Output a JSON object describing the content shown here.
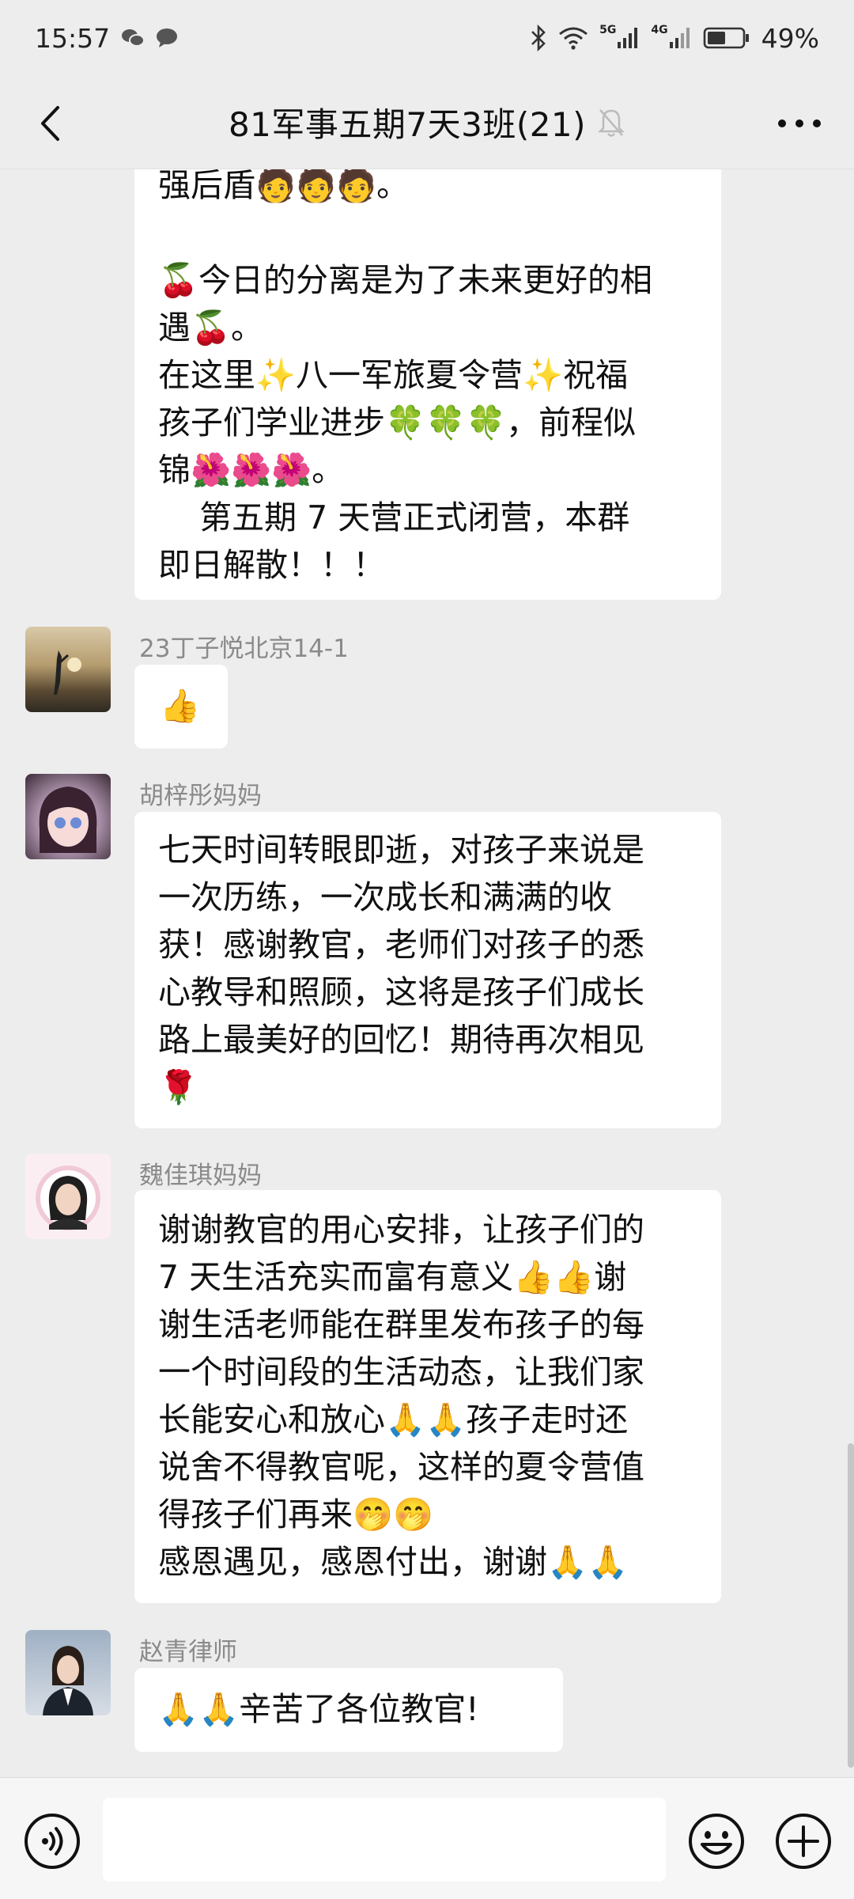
{
  "status_bar": {
    "time": "15:57",
    "battery": "49%",
    "net_5g": "5G",
    "net_4g": "4G"
  },
  "header": {
    "title": "81军事五期7天3班(21)"
  },
  "messages": [
    {
      "sender": "",
      "lines": [
        "强后盾🧑🧑🧑。",
        "",
        "🍒今日的分离是为了未来更好的相",
        "遇🍒。",
        "在这里✨八一军旅夏令营✨祝福",
        "孩子们学业进步🍀🍀🍀，前程似",
        "锦🌺🌺🌺。",
        "    第五期 7 天营正式闭营，本群",
        "即日解散！！！"
      ]
    },
    {
      "sender": "23丁子悦北京14-1",
      "lines": [
        "👍"
      ]
    },
    {
      "sender": "胡梓彤妈妈",
      "lines": [
        "七天时间转眼即逝，对孩子来说是",
        "一次历练，一次成长和满满的收",
        "获！感谢教官，老师们对孩子的悉",
        "心教导和照顾，这将是孩子们成长",
        "路上最美好的回忆！期待再次相见",
        "🌹"
      ]
    },
    {
      "sender": "魏佳琪妈妈",
      "lines": [
        "谢谢教官的用心安排，让孩子们的",
        "7 天生活充实而富有意义👍👍谢",
        "谢生活老师能在群里发布孩子的每",
        "一个时间段的生活动态，让我们家",
        "长能安心和放心🙏🙏孩子走时还",
        "说舍不得教官呢，这样的夏令营值",
        "得孩子们再来🤭🤭",
        "感恩遇见，感恩付出，谢谢🙏🙏"
      ]
    },
    {
      "sender": "赵青律师",
      "lines": [
        "🙏🙏辛苦了各位教官!"
      ]
    }
  ]
}
